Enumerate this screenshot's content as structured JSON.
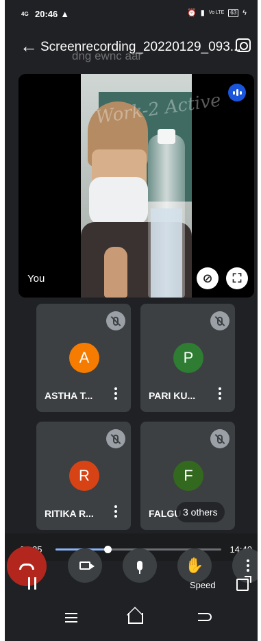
{
  "status_bar": {
    "network": "4G",
    "time": "20:46",
    "volte": "Vo LTE",
    "battery": "63"
  },
  "header": {
    "back_icon": "arrow-left-icon",
    "title": "Screenrecording_20220129_093...",
    "ghost_title": "dng ewnc aar",
    "screenshot_icon": "camera-icon"
  },
  "self_view": {
    "label": "You",
    "board_text": "Work-2 Active",
    "speaking_icon": "speaking-indicator-icon",
    "pin_icon": "pin-off-icon",
    "fullscreen_icon": "fullscreen-icon"
  },
  "participants": [
    {
      "initial": "A",
      "name": "ASTHA T...",
      "color": "#f57c00",
      "muted": true
    },
    {
      "initial": "P",
      "name": "PARI KU...",
      "color": "#2e7d32",
      "muted": true
    },
    {
      "initial": "R",
      "name": "RITIKA R...",
      "color": "#d84315",
      "muted": true
    },
    {
      "initial": "F",
      "name": "FALGU",
      "color": "#33691e",
      "muted": true
    }
  ],
  "others_label": "3 others",
  "player": {
    "current_time": "04:35",
    "total_time": "14:40",
    "progress": 0.312
  },
  "controls": {
    "speed_label": "Speed"
  },
  "colors": {
    "background": "#202124",
    "tile": "#3c4043",
    "accent": "#8ab4f8",
    "end_call": "#b3261e"
  }
}
